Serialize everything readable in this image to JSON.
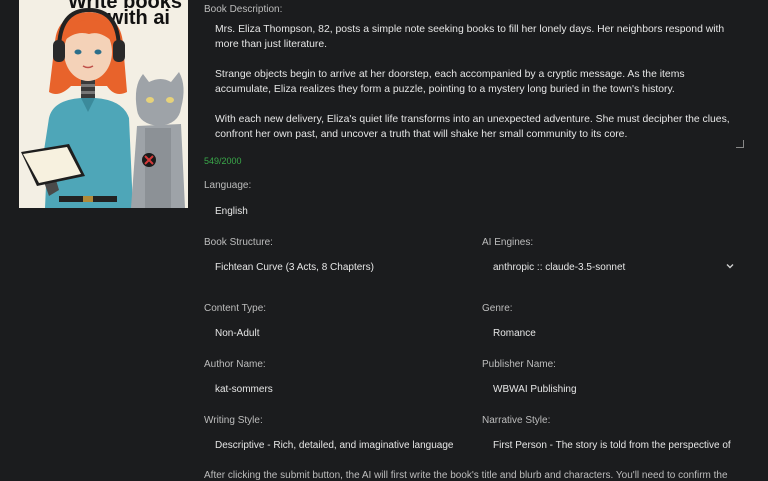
{
  "cover": {
    "line1": "Write books",
    "line2": "with ai"
  },
  "description": {
    "label": "Book Description:",
    "paragraphs": [
      "Mrs. Eliza Thompson, 82, posts a simple note seeking books to fill her lonely days. Her neighbors respond with more than just literature.",
      "Strange objects begin to arrive at her doorstep, each accompanied by a cryptic message. As the items accumulate, Eliza realizes they form a puzzle, pointing to a mystery long buried in the town's history.",
      "With each new delivery, Eliza's quiet life transforms into an unexpected adventure. She must decipher the clues, confront her own past, and uncover a truth that will shake her small community to its core."
    ],
    "counter": "549/2000"
  },
  "language": {
    "label": "Language:",
    "value": "English"
  },
  "structure": {
    "label": "Book Structure:",
    "value": "Fichtean Curve (3 Acts, 8 Chapters)"
  },
  "ai_engine": {
    "label": "AI Engines:",
    "value": "anthropic :: claude-3.5-sonnet"
  },
  "content_type": {
    "label": "Content Type:",
    "value": "Non-Adult"
  },
  "genre": {
    "label": "Genre:",
    "value": "Romance"
  },
  "author": {
    "label": "Author Name:",
    "value": "kat-sommers"
  },
  "publisher": {
    "label": "Publisher Name:",
    "value": "WBWAI Publishing"
  },
  "writing_style": {
    "label": "Writing Style:",
    "value": "Descriptive - Rich, detailed, and imaginative language"
  },
  "narrative_style": {
    "label": "Narrative Style:",
    "value": "First Person - The story is told from the perspective of a character"
  },
  "footer": "After clicking the submit button, the AI will first write the book's title and blurb and characters. You'll need to confirm the",
  "colors": {
    "background": "#1b1c1e",
    "counter": "#3aa84a",
    "hair": "#e8632b",
    "shirt": "#4ea6b8"
  }
}
